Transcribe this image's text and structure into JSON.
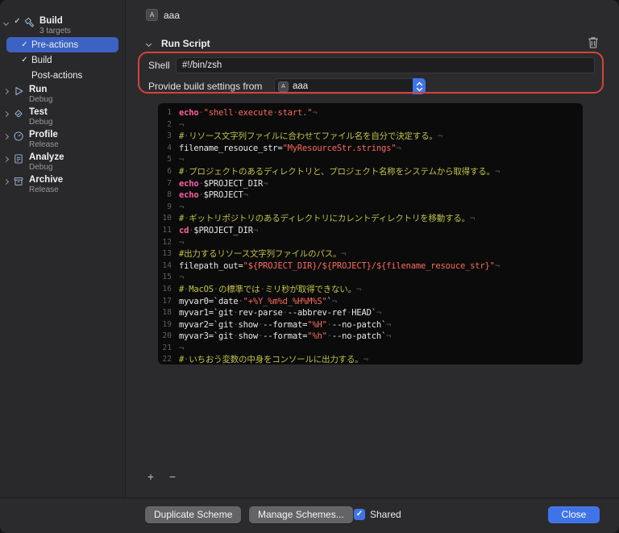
{
  "colors": {
    "selection_blue": "#3c63c4",
    "accent_blue": "#3f74e8",
    "annotation_red": "#d5433a",
    "editor_background": "#0b0b0b",
    "code_keyword": "#fc5fa3",
    "code_string": "#fc6a5d",
    "code_comment": "#c2c24a",
    "code_plain": "#e9e9e9",
    "code_invisible": "#5d5d5d"
  },
  "icons": {
    "check": "✓",
    "add": "+",
    "remove": "−",
    "app_letter": "A"
  },
  "sidebar": {
    "items": [
      {
        "type": "group",
        "label": "Build",
        "sub": "3 targets",
        "icon": "hammer-icon",
        "checked": true,
        "expanded": true
      },
      {
        "type": "child",
        "label": "Pre-actions",
        "checked": true,
        "selected": true
      },
      {
        "type": "child",
        "label": "Build",
        "checked": true,
        "selected": false
      },
      {
        "type": "child",
        "label": "Post-actions",
        "checked": false,
        "selected": false
      },
      {
        "type": "group",
        "label": "Run",
        "sub": "Debug",
        "icon": "play-icon",
        "checked": false,
        "expanded": false
      },
      {
        "type": "group",
        "label": "Test",
        "sub": "Debug",
        "icon": "test-icon",
        "checked": false,
        "expanded": false
      },
      {
        "type": "group",
        "label": "Profile",
        "sub": "Release",
        "icon": "profile-icon",
        "checked": false,
        "expanded": false
      },
      {
        "type": "group",
        "label": "Analyze",
        "sub": "Debug",
        "icon": "analyze-icon",
        "checked": false,
        "expanded": false
      },
      {
        "type": "group",
        "label": "Archive",
        "sub": "Release",
        "icon": "archive-icon",
        "checked": false,
        "expanded": false
      }
    ]
  },
  "header": {
    "target_name": "aaa"
  },
  "run_script": {
    "title": "Run Script",
    "shell_label": "Shell",
    "shell_value": "#!/bin/zsh",
    "settings_label": "Provide build settings from",
    "settings_value": "aaa",
    "code_lines": [
      {
        "n": 1,
        "segs": [
          [
            "echo ",
            "kw"
          ],
          [
            "\"shell execute start.\"",
            "str"
          ],
          [
            "¬",
            "inv"
          ]
        ]
      },
      {
        "n": 2,
        "segs": [
          [
            "¬",
            "inv"
          ]
        ]
      },
      {
        "n": 3,
        "segs": [
          [
            "# リソース文字列ファイルに合わせてファイル名を自分で決定する。",
            "com"
          ],
          [
            "¬",
            "inv"
          ]
        ]
      },
      {
        "n": 4,
        "segs": [
          [
            "filename_resouce_str=",
            "pl"
          ],
          [
            "\"MyResourceStr.strings\"",
            "str"
          ],
          [
            "¬",
            "inv"
          ]
        ]
      },
      {
        "n": 5,
        "segs": [
          [
            "¬",
            "inv"
          ]
        ]
      },
      {
        "n": 6,
        "segs": [
          [
            "# プロジェクトのあるディレクトリと、プロジェクト名称をシステムから取得する。",
            "com"
          ],
          [
            "¬",
            "inv"
          ]
        ]
      },
      {
        "n": 7,
        "segs": [
          [
            "echo ",
            "kw"
          ],
          [
            "$PROJECT_DIR",
            "pl"
          ],
          [
            "¬",
            "inv"
          ]
        ]
      },
      {
        "n": 8,
        "segs": [
          [
            "echo ",
            "kw"
          ],
          [
            "$PROJECT",
            "pl"
          ],
          [
            "¬",
            "inv"
          ]
        ]
      },
      {
        "n": 9,
        "segs": [
          [
            "¬",
            "inv"
          ]
        ]
      },
      {
        "n": 10,
        "segs": [
          [
            "# ギットリポジトリのあるディレクトリにカレントディレクトリを移動する。",
            "com"
          ],
          [
            "¬",
            "inv"
          ]
        ]
      },
      {
        "n": 11,
        "segs": [
          [
            "cd ",
            "kw"
          ],
          [
            "$PROJECT_DIR",
            "pl"
          ],
          [
            "¬",
            "inv"
          ]
        ]
      },
      {
        "n": 12,
        "segs": [
          [
            "¬",
            "inv"
          ]
        ]
      },
      {
        "n": 13,
        "segs": [
          [
            "#出力するリソース文字列ファイルのパス。",
            "com"
          ],
          [
            "¬",
            "inv"
          ]
        ]
      },
      {
        "n": 14,
        "segs": [
          [
            "filepath_out=",
            "pl"
          ],
          [
            "\"${PROJECT_DIR}/${PROJECT}/${filename_resouce_str}\"",
            "str"
          ],
          [
            "¬",
            "inv"
          ]
        ]
      },
      {
        "n": 15,
        "segs": [
          [
            "¬",
            "inv"
          ]
        ]
      },
      {
        "n": 16,
        "segs": [
          [
            "# MacOS の標準では ミリ秒が取得できない。",
            "com"
          ],
          [
            "¬",
            "inv"
          ]
        ]
      },
      {
        "n": 17,
        "segs": [
          [
            "myvar0=`date ",
            "pl"
          ],
          [
            "\"+%Y_%m%d_%H%M%S\"",
            "str"
          ],
          [
            "`",
            "pl"
          ],
          [
            "¬",
            "inv"
          ]
        ]
      },
      {
        "n": 18,
        "segs": [
          [
            "myvar1=`git rev-parse --abbrev-ref HEAD`",
            "pl"
          ],
          [
            "¬",
            "inv"
          ]
        ]
      },
      {
        "n": 19,
        "segs": [
          [
            "myvar2=`git show --format=",
            "pl"
          ],
          [
            "\"%H\"",
            "str"
          ],
          [
            " --no-patch`",
            "pl"
          ],
          [
            "¬",
            "inv"
          ]
        ]
      },
      {
        "n": 20,
        "segs": [
          [
            "myvar3=`git show --format=",
            "pl"
          ],
          [
            "\"%h\"",
            "str"
          ],
          [
            " --no-patch`",
            "pl"
          ],
          [
            "¬",
            "inv"
          ]
        ]
      },
      {
        "n": 21,
        "segs": [
          [
            "¬",
            "inv"
          ]
        ]
      },
      {
        "n": 22,
        "segs": [
          [
            "# いちおう変数の中身をコンソールに出力する。",
            "com"
          ],
          [
            "¬",
            "inv"
          ]
        ]
      }
    ]
  },
  "footer": {
    "duplicate_label": "Duplicate Scheme",
    "manage_label": "Manage Schemes...",
    "shared_label": "Shared",
    "shared_checked": true,
    "close_label": "Close"
  }
}
